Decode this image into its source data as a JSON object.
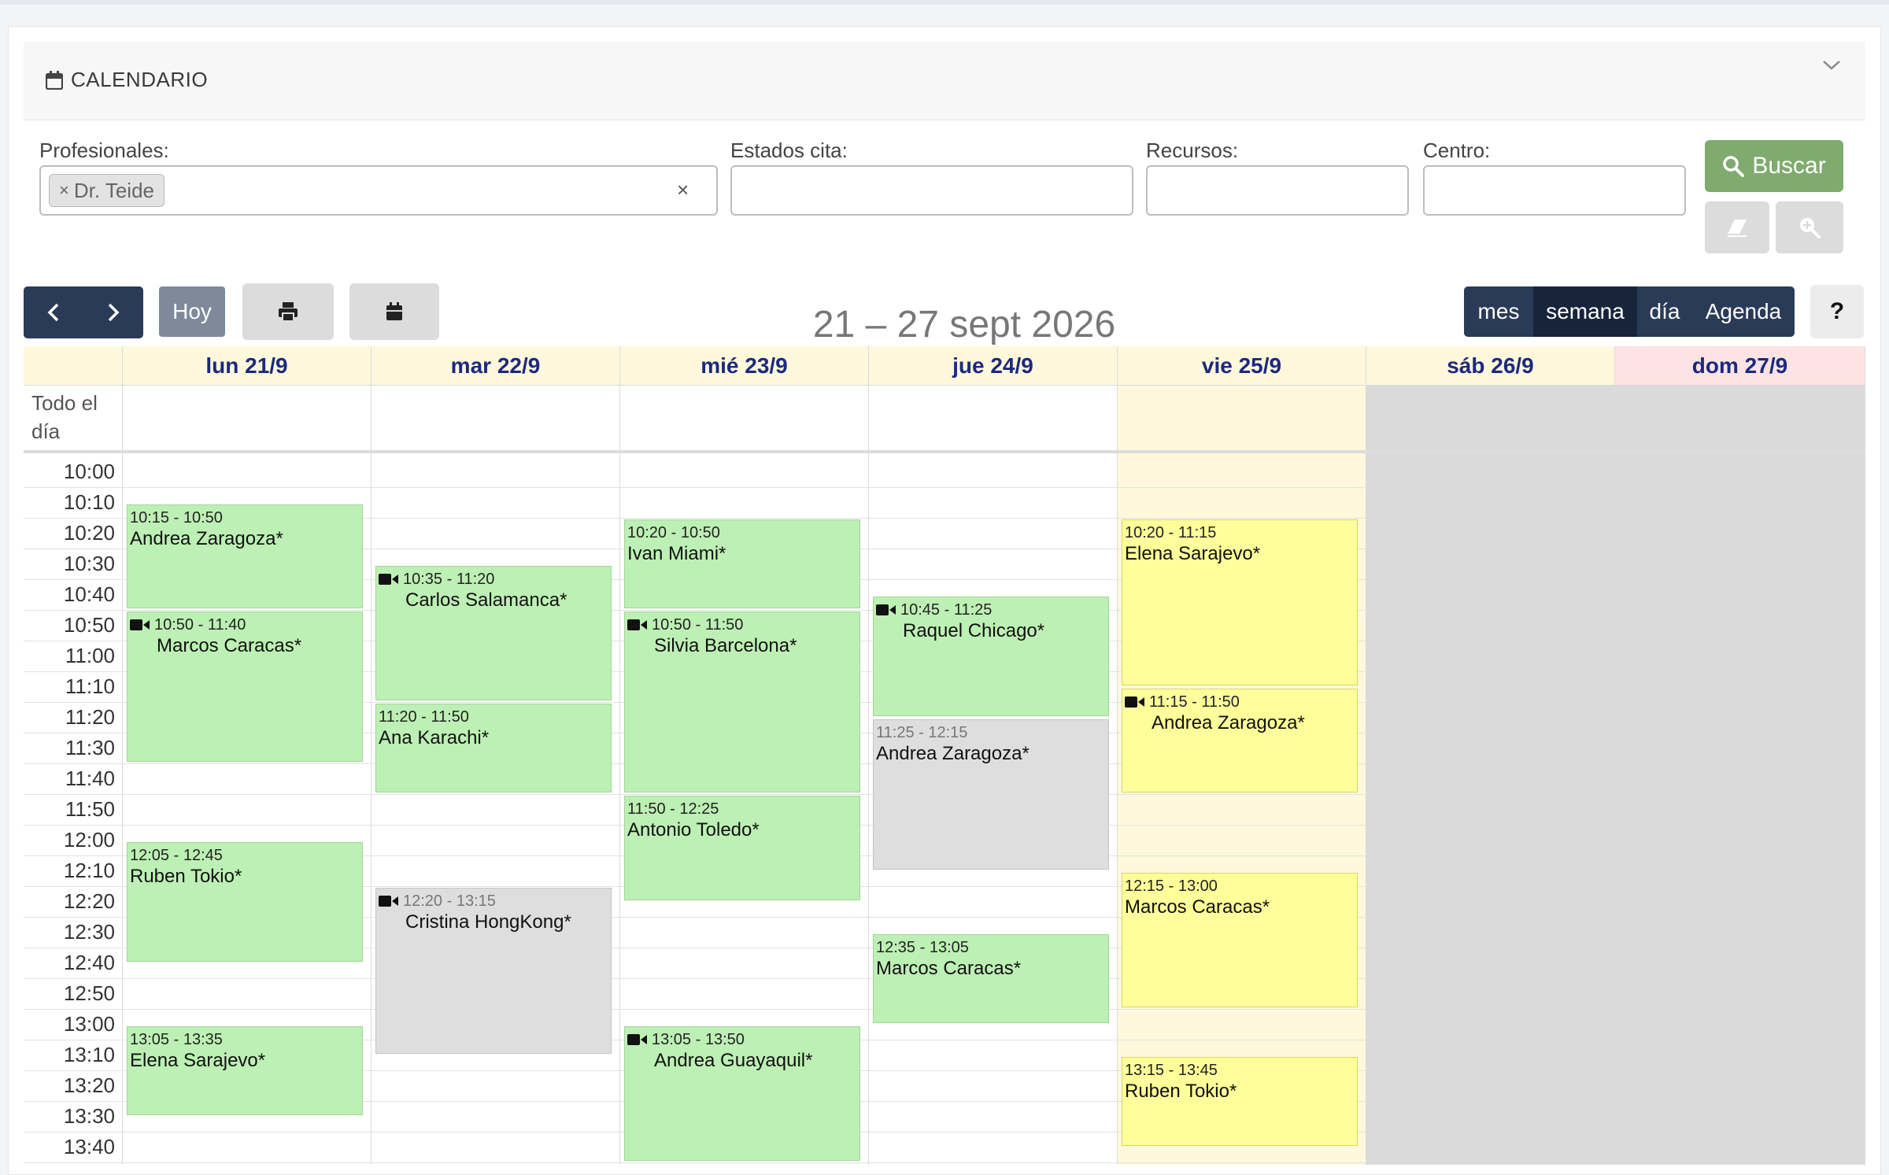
{
  "header": {
    "title": "CALENDARIO"
  },
  "filters": {
    "profesionales_label": "Profesionales:",
    "profesionales_tag": "Dr. Teide",
    "tag_remove": "×",
    "clear": "×",
    "estados_label": "Estados cita:",
    "recursos_label": "Recursos:",
    "centro_label": "Centro:",
    "buscar_label": "Buscar"
  },
  "toolbar": {
    "hoy_label": "Hoy",
    "range_title": "21 – 27 sept 2026",
    "views": [
      "mes",
      "semana",
      "día",
      "Agenda"
    ],
    "active_view": "semana",
    "help_label": "?"
  },
  "calendar": {
    "all_day_label": "Todo el día",
    "days": [
      "lun 21/9",
      "mar 22/9",
      "mié 23/9",
      "jue 24/9",
      "vie 25/9",
      "sáb 26/9",
      "dom 27/9"
    ],
    "times": [
      "10:00",
      "10:10",
      "10:20",
      "10:30",
      "10:40",
      "10:50",
      "11:00",
      "11:10",
      "11:20",
      "11:30",
      "11:40",
      "11:50",
      "12:00",
      "12:10",
      "12:20",
      "12:30",
      "12:40",
      "12:50",
      "13:00",
      "13:10",
      "13:20",
      "13:30",
      "13:40"
    ],
    "events": [
      {
        "day": 0,
        "start": "10:15",
        "end": "10:50",
        "time": "10:15 - 10:50",
        "name": "Andrea Zaragoza*",
        "color": "green",
        "video": false
      },
      {
        "day": 0,
        "start": "10:50",
        "end": "11:40",
        "time": "10:50 - 11:40",
        "name": "Marcos Caracas*",
        "color": "green",
        "video": true
      },
      {
        "day": 0,
        "start": "12:05",
        "end": "12:45",
        "time": "12:05 - 12:45",
        "name": "Ruben Tokio*",
        "color": "green",
        "video": false
      },
      {
        "day": 0,
        "start": "13:05",
        "end": "13:35",
        "time": "13:05 - 13:35",
        "name": "Elena Sarajevo*",
        "color": "green",
        "video": false
      },
      {
        "day": 1,
        "start": "10:35",
        "end": "11:20",
        "time": "10:35 - 11:20",
        "name": "Carlos Salamanca*",
        "color": "green",
        "video": true
      },
      {
        "day": 1,
        "start": "11:20",
        "end": "11:50",
        "time": "11:20 - 11:50",
        "name": "Ana Karachi*",
        "color": "green",
        "video": false
      },
      {
        "day": 1,
        "start": "12:20",
        "end": "13:15",
        "time": "12:20 - 13:15",
        "name": "Cristina HongKong*",
        "color": "grey",
        "video": true
      },
      {
        "day": 2,
        "start": "10:20",
        "end": "10:50",
        "time": "10:20 - 10:50",
        "name": "Ivan Miami*",
        "color": "green",
        "video": false
      },
      {
        "day": 2,
        "start": "10:50",
        "end": "11:50",
        "time": "10:50 - 11:50",
        "name": "Silvia Barcelona*",
        "color": "green",
        "video": true
      },
      {
        "day": 2,
        "start": "11:50",
        "end": "12:25",
        "time": "11:50 - 12:25",
        "name": "Antonio Toledo*",
        "color": "green",
        "video": false
      },
      {
        "day": 2,
        "start": "13:05",
        "end": "13:50",
        "time": "13:05 - 13:50",
        "name": "Andrea Guayaquil*",
        "color": "green",
        "video": true
      },
      {
        "day": 3,
        "start": "10:45",
        "end": "11:25",
        "time": "10:45 - 11:25",
        "name": "Raquel Chicago*",
        "color": "green",
        "video": true
      },
      {
        "day": 3,
        "start": "11:25",
        "end": "12:15",
        "time": "11:25 - 12:15",
        "name": "Andrea Zaragoza*",
        "color": "grey",
        "video": false
      },
      {
        "day": 3,
        "start": "12:35",
        "end": "13:05",
        "time": "12:35 - 13:05",
        "name": "Marcos Caracas*",
        "color": "green",
        "video": false
      },
      {
        "day": 4,
        "start": "10:20",
        "end": "11:15",
        "time": "10:20 - 11:15",
        "name": "Elena Sarajevo*",
        "color": "yellow",
        "video": false
      },
      {
        "day": 4,
        "start": "11:15",
        "end": "11:50",
        "time": "11:15 - 11:50",
        "name": "Andrea Zaragoza*",
        "color": "yellow",
        "video": true
      },
      {
        "day": 4,
        "start": "12:15",
        "end": "13:00",
        "time": "12:15 - 13:00",
        "name": "Marcos Caracas*",
        "color": "yellow",
        "video": false
      },
      {
        "day": 4,
        "start": "13:15",
        "end": "13:45",
        "time": "13:15 - 13:45",
        "name": "Ruben Tokio*",
        "color": "yellow",
        "video": false
      }
    ]
  },
  "colors": {
    "green": "#bdf0b4",
    "grey": "#dedede",
    "yellow": "#fffe9a",
    "header_bg": "#fff8dc",
    "sunday_bg": "#fde3e3",
    "weekend_bg": "#dadada",
    "today_bg": "#fff8dc",
    "nav_dark": "#2a3b57",
    "buscar": "#7fab6f"
  }
}
